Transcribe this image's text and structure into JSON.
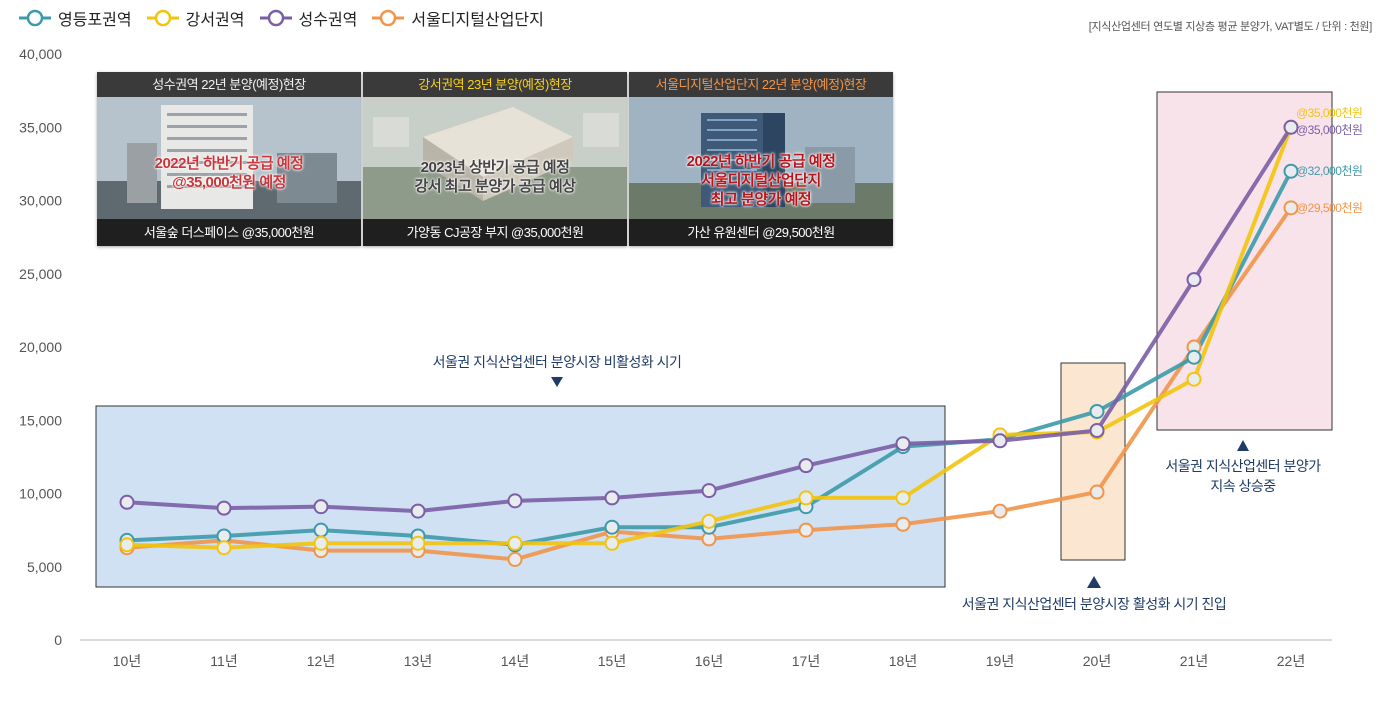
{
  "legend": {
    "series": [
      {
        "label": "영등포권역",
        "color": "#3c9aaa"
      },
      {
        "label": "강서권역",
        "color": "#f2c40d"
      },
      {
        "label": "성수권역",
        "color": "#7a5ea6"
      },
      {
        "label": "서울디지털산업단지",
        "color": "#f0954a"
      }
    ]
  },
  "unit_note": "[지식산업센터 연도별 지상층 평균 분양가, VAT별도 / 단위 : 천원]",
  "photo_cards": [
    {
      "title": "성수권역 22년 분양(예정)현장",
      "title_color": "#f2f2f2",
      "caption_lines": [
        "2022년 하반기 공급 예정",
        "@35,000천원 예정"
      ],
      "caption_color": "#c9373c",
      "footer": "서울숲 더스페이스 @35,000천원",
      "sky": "#b7c3cc",
      "ground": "#5f6a70",
      "building": "#e8e8e6"
    },
    {
      "title": "강서권역 23년 분양(예정)현장",
      "title_color": "#f7d21a",
      "caption_lines": [
        "2023년 상반기 공급 예정",
        "강서 최고 분양가 공급 예상"
      ],
      "caption_color": "#444444",
      "footer": "가양동 CJ공장 부지 @35,000천원",
      "sky": "#c8cfc9",
      "ground": "#8f9b8a",
      "building": "#e6e2d8"
    },
    {
      "title": "서울디지털산업단지 22년 분양(예정)현장",
      "title_color": "#f0954a",
      "caption_lines": [
        "2022년 하반기 공급 예정",
        "서울디지털산업단지",
        "최고 분양가 예정"
      ],
      "caption_color": "#b8141c",
      "footer": "가산 유원센터 @29,500천원",
      "sky": "#9fb3c2",
      "ground": "#6c7a6a",
      "building": "#3f5a78"
    }
  ],
  "annotations": {
    "inactive": "서울권 지식산업센터 분양시장 비활성화 시기",
    "activation": "서울권 지식산업센터 분양시장 활성화 시기 진입",
    "rising_lines": [
      "서울권 지식산업센터 분양가",
      "지속 상승중"
    ],
    "end_labels": [
      {
        "text": "@35,000천원",
        "color": "#f2c40d"
      },
      {
        "text": "@35,000천원",
        "color": "#7a5ea6"
      },
      {
        "text": "@32,000천원",
        "color": "#3c9aaa"
      },
      {
        "text": "@29,500천원",
        "color": "#f0954a"
      }
    ]
  },
  "chart_data": {
    "type": "line",
    "categories": [
      "10년",
      "11년",
      "12년",
      "13년",
      "14년",
      "15년",
      "16년",
      "17년",
      "18년",
      "19년",
      "20년",
      "21년",
      "22년"
    ],
    "ylim": [
      0,
      40000
    ],
    "yticks": [
      "0",
      "5,000",
      "10,000",
      "15,000",
      "20,000",
      "25,000",
      "30,000",
      "35,000",
      "40,000"
    ],
    "grid": false,
    "legend_position": "top-left",
    "series": [
      {
        "name": "영등포권역",
        "color": "#3c9aaa",
        "values": [
          6800,
          7100,
          7500,
          7100,
          6500,
          7700,
          7700,
          9100,
          13200,
          13700,
          15600,
          19300,
          32000
        ]
      },
      {
        "name": "강서권역",
        "color": "#f2c40d",
        "values": [
          6500,
          6300,
          6600,
          6600,
          6600,
          6600,
          8100,
          9700,
          9700,
          14000,
          14200,
          17800,
          35000
        ]
      },
      {
        "name": "성수권역",
        "color": "#7a5ea6",
        "values": [
          9400,
          9000,
          9100,
          8800,
          9500,
          9700,
          10200,
          11900,
          13400,
          13600,
          14300,
          24600,
          35000
        ]
      },
      {
        "name": "서울디지털산업단지",
        "color": "#f0954a",
        "values": [
          6300,
          6800,
          6100,
          6100,
          5500,
          7400,
          6900,
          7500,
          7900,
          8800,
          10100,
          20000,
          29500
        ]
      }
    ]
  }
}
